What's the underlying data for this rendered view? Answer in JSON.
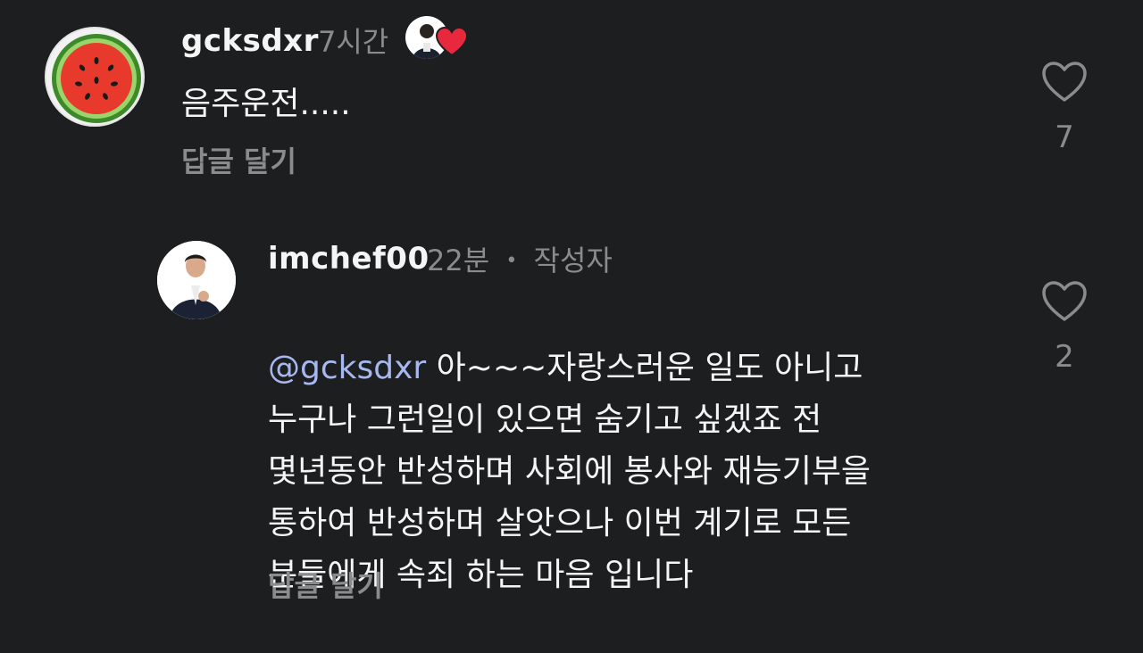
{
  "comments": [
    {
      "username": "gcksdxr",
      "time": "7시간",
      "text": "음주운전.....",
      "reply_label": "답글 달기",
      "likes": "7",
      "avatar_icon": "watermelon-icon",
      "liked_by_author": true
    },
    {
      "username": "imchef00",
      "time": "22분",
      "separator": "•",
      "author_label": "작성자",
      "mention": "@gcksdxr",
      "text_first": " 아~~~자랑스러운 일도 아니고",
      "text_rest": "누구나 그런일이 있으면 숨기고 싶겠죠 전\n몇년동안 반성하며 사회에 봉사와 재능기부을\n통하여 반성하며 살앗으나 이번 계기로 모든\n분들에게 속죄 하는 마음 입니다",
      "reply_label": "답글 달기",
      "likes": "2",
      "avatar_icon": "profile-photo-icon"
    }
  ],
  "colors": {
    "background": "#1d1e20",
    "text": "#f5f5f5",
    "muted": "#8a8b8d",
    "mention": "#a7b8f0",
    "heart_badge": "#e8283c"
  }
}
